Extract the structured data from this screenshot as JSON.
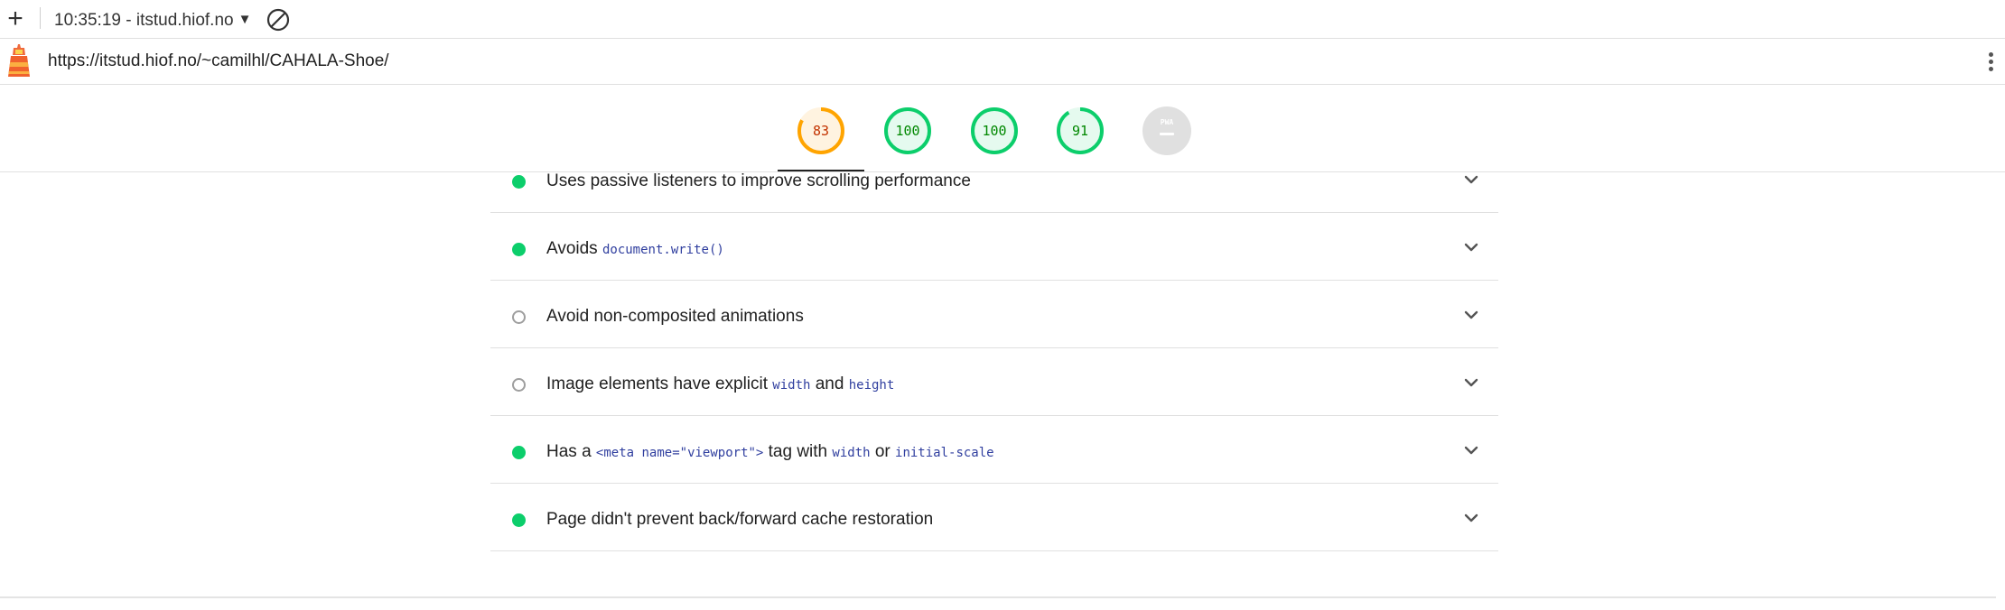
{
  "toolbar": {
    "add_label": "+",
    "report_label": "10:35:19 - itstud.hiof.no",
    "caret": "▼"
  },
  "urlbar": {
    "url": "https://itstud.hiof.no/~camilhl/CAHALA-Shoe/"
  },
  "scores": [
    {
      "value": "83",
      "score": 0.83,
      "color": "#ffa400",
      "text_color": "#c33300",
      "bg": "#fff3e0"
    },
    {
      "value": "100",
      "score": 1.0,
      "color": "#0cce6b",
      "text_color": "#008800",
      "bg": "#e5faef"
    },
    {
      "value": "100",
      "score": 1.0,
      "color": "#0cce6b",
      "text_color": "#008800",
      "bg": "#e5faef"
    },
    {
      "value": "91",
      "score": 0.91,
      "color": "#0cce6b",
      "text_color": "#008800",
      "bg": "#e5faef"
    },
    {
      "value": "PWA",
      "score": 0,
      "color": "#e0e0e0",
      "text_color": "#9e9e9e",
      "bg": "#e0e0e0"
    }
  ],
  "audits": [
    {
      "status": "pass",
      "parts": [
        {
          "t": "Uses passive listeners to improve scrolling performance"
        }
      ]
    },
    {
      "status": "pass",
      "parts": [
        {
          "t": "Avoids "
        },
        {
          "c": "document.write()"
        }
      ]
    },
    {
      "status": "info",
      "parts": [
        {
          "t": "Avoid non-composited animations"
        }
      ]
    },
    {
      "status": "info",
      "parts": [
        {
          "t": "Image elements have explicit "
        },
        {
          "c": "width"
        },
        {
          "t": " and "
        },
        {
          "c": "height"
        }
      ]
    },
    {
      "status": "pass",
      "parts": [
        {
          "t": "Has a "
        },
        {
          "c": "<meta name=\"viewport\">"
        },
        {
          "t": " tag with "
        },
        {
          "c": "width"
        },
        {
          "t": " or "
        },
        {
          "c": "initial-scale"
        }
      ]
    },
    {
      "status": "pass",
      "parts": [
        {
          "t": "Page didn't prevent back/forward cache restoration"
        }
      ]
    }
  ],
  "colors": {
    "pass": "#0cce6b",
    "average": "#ffa400",
    "informative": "#9e9e9e",
    "code": "#303f9f"
  }
}
